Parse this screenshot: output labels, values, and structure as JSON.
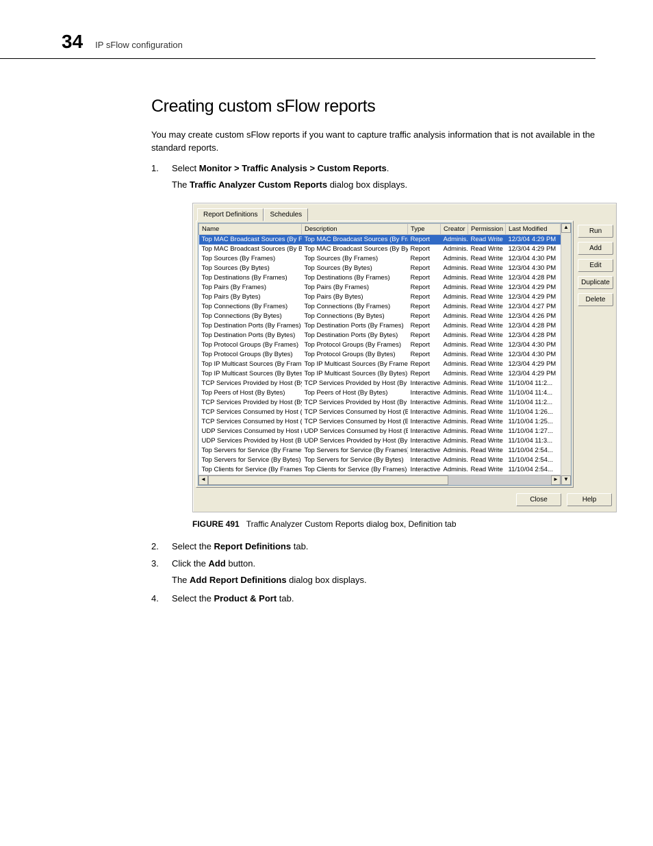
{
  "header": {
    "page_number": "34",
    "section": "IP sFlow configuration"
  },
  "title": "Creating custom sFlow reports",
  "intro": "You may create custom sFlow reports if you want to capture traffic analysis information that is not available in the standard reports.",
  "steps": {
    "s1_num": "1.",
    "s1_pre": "Select ",
    "s1_strong": "Monitor > Traffic Analysis > Custom Reports",
    "s1_post": ".",
    "s1_ind_pre": "The ",
    "s1_ind_strong": "Traffic Analyzer Custom Reports",
    "s1_ind_post": " dialog box displays.",
    "s2_num": "2.",
    "s2_pre": "Select the ",
    "s2_strong": "Report Definitions",
    "s2_post": " tab.",
    "s3_num": "3.",
    "s3_pre": "Click the ",
    "s3_strong": "Add",
    "s3_post": " button.",
    "s3_ind_pre": "The ",
    "s3_ind_strong": "Add Report Definitions",
    "s3_ind_post": " dialog box displays.",
    "s4_num": "4.",
    "s4_pre": "Select the ",
    "s4_strong": "Product & Port",
    "s4_post": " tab."
  },
  "dialog": {
    "tabs": {
      "t1": "Report Definitions",
      "t2": "Schedules"
    },
    "columns": {
      "name": "Name",
      "desc": "Description",
      "type": "Type",
      "creator": "Creator",
      "perm": "Permission",
      "mod": "Last Modified"
    },
    "side_buttons": {
      "run": "Run",
      "add": "Add",
      "edit": "Edit",
      "dup": "Duplicate",
      "del": "Delete"
    },
    "bottom_buttons": {
      "close": "Close",
      "help": "Help"
    },
    "rows": [
      {
        "name": "Top MAC Broadcast Sources (By Fram...",
        "desc": "Top MAC Broadcast Sources (By Frames)",
        "type": "Report",
        "creator": "Adminis...",
        "perm": "Read Write",
        "mod": "12/3/04 4:29 PM",
        "sel": true
      },
      {
        "name": "Top MAC Broadcast Sources (By Bytes)",
        "desc": "Top MAC Broadcast Sources (By Bytes)",
        "type": "Report",
        "creator": "Adminis...",
        "perm": "Read Write",
        "mod": "12/3/04 4:29 PM"
      },
      {
        "name": "Top Sources (By Frames)",
        "desc": "Top Sources (By Frames)",
        "type": "Report",
        "creator": "Adminis...",
        "perm": "Read Write",
        "mod": "12/3/04 4:30 PM"
      },
      {
        "name": "Top Sources (By Bytes)",
        "desc": "Top Sources (By Bytes)",
        "type": "Report",
        "creator": "Adminis...",
        "perm": "Read Write",
        "mod": "12/3/04 4:30 PM"
      },
      {
        "name": "Top Destinations (By Frames)",
        "desc": "Top Destinations (By Frames)",
        "type": "Report",
        "creator": "Adminis...",
        "perm": "Read Write",
        "mod": "12/3/04 4:28 PM"
      },
      {
        "name": "Top Pairs (By Frames)",
        "desc": "Top Pairs  (By Frames)",
        "type": "Report",
        "creator": "Adminis...",
        "perm": "Read Write",
        "mod": "12/3/04 4:29 PM"
      },
      {
        "name": "Top Pairs (By Bytes)",
        "desc": "Top Pairs  (By Bytes)",
        "type": "Report",
        "creator": "Adminis...",
        "perm": "Read Write",
        "mod": "12/3/04 4:29 PM"
      },
      {
        "name": "Top Connections (By Frames)",
        "desc": "Top Connections  (By Frames)",
        "type": "Report",
        "creator": "Adminis...",
        "perm": "Read Write",
        "mod": "12/3/04 4:27 PM"
      },
      {
        "name": "Top Connections (By Bytes)",
        "desc": "Top Connections  (By Bytes)",
        "type": "Report",
        "creator": "Adminis...",
        "perm": "Read Write",
        "mod": "12/3/04 4:26 PM"
      },
      {
        "name": "Top Destination Ports (By Frames)",
        "desc": "Top Destination Ports (By Frames)",
        "type": "Report",
        "creator": "Adminis...",
        "perm": "Read Write",
        "mod": "12/3/04 4:28 PM"
      },
      {
        "name": "Top Destination Ports (By Bytes)",
        "desc": "Top Destination Ports (By Bytes)",
        "type": "Report",
        "creator": "Adminis...",
        "perm": "Read Write",
        "mod": "12/3/04 4:28 PM"
      },
      {
        "name": "Top Protocol Groups (By Frames)",
        "desc": "Top Protocol Groups (By Frames)",
        "type": "Report",
        "creator": "Adminis...",
        "perm": "Read Write",
        "mod": "12/3/04 4:30 PM"
      },
      {
        "name": "Top Protocol Groups (By Bytes)",
        "desc": "Top Protocol Groups (By Bytes)",
        "type": "Report",
        "creator": "Adminis...",
        "perm": "Read Write",
        "mod": "12/3/04 4:30 PM"
      },
      {
        "name": "Top IP Multicast Sources (By Frames)",
        "desc": "Top IP Multicast Sources (By Frames)",
        "type": "Report",
        "creator": "Adminis...",
        "perm": "Read Write",
        "mod": "12/3/04 4:29 PM"
      },
      {
        "name": "Top IP Multicast Sources (By Bytes)",
        "desc": "Top IP Multicast Sources (By Bytes)",
        "type": "Report",
        "creator": "Adminis...",
        "perm": "Read Write",
        "mod": "12/3/04 4:29 PM"
      },
      {
        "name": "TCP Services Provided by Host (By Fr...",
        "desc": "TCP Services Provided by Host (By Frames)",
        "type": "Interactive",
        "creator": "Adminis...",
        "perm": "Read Write",
        "mod": "11/10/04 11:2..."
      },
      {
        "name": "Top Peers of Host (By Bytes)",
        "desc": "Top Peers of Host (By Bytes)",
        "type": "Interactive",
        "creator": "Adminis...",
        "perm": "Read Write",
        "mod": "11/10/04 11:4..."
      },
      {
        "name": "TCP Services Provided by Host (By By...",
        "desc": "TCP Services Provided by Host (By Bytes)",
        "type": "Interactive",
        "creator": "Adminis...",
        "perm": "Read Write",
        "mod": "11/10/04 11:2..."
      },
      {
        "name": "TCP Services Consumed by Host (By F...",
        "desc": "TCP Services Consumed by Host (By Fram...",
        "type": "Interactive",
        "creator": "Adminis...",
        "perm": "Read Write",
        "mod": "11/10/04 1:26..."
      },
      {
        "name": "TCP Services Consumed by Host (By ...",
        "desc": "TCP Services Consumed by Host (By Bytes)",
        "type": "Interactive",
        "creator": "Adminis...",
        "perm": "Read Write",
        "mod": "11/10/04 1:25..."
      },
      {
        "name": "UDP Services Consumed by Host (By ...",
        "desc": "UDP Services Consumed by Host (By Fram...",
        "type": "Interactive",
        "creator": "Adminis...",
        "perm": "Read Write",
        "mod": "11/10/04 1:27..."
      },
      {
        "name": "UDP Services Provided by Host (By By...",
        "desc": "UDP Services Provided by Host (By Bytes)",
        "type": "Interactive",
        "creator": "Adminis...",
        "perm": "Read Write",
        "mod": "11/10/04 11:3..."
      },
      {
        "name": "Top Servers for Service (By Frames)",
        "desc": "Top Servers for Service (By Frames)",
        "type": "Interactive",
        "creator": "Adminis...",
        "perm": "Read Write",
        "mod": "11/10/04 2:54..."
      },
      {
        "name": "Top Servers for Service (By Bytes)",
        "desc": "Top Servers for Service (By Bytes)",
        "type": "Interactive",
        "creator": "Adminis...",
        "perm": "Read Write",
        "mod": "11/10/04 2:54..."
      },
      {
        "name": "Top Clients for Service (By Frames)",
        "desc": "Top Clients for Service (By Frames)",
        "type": "Interactive",
        "creator": "Adminis...",
        "perm": "Read Write",
        "mod": "11/10/04 2:54..."
      }
    ]
  },
  "figure": {
    "label": "FIGURE 491",
    "caption": "Traffic Analyzer Custom Reports dialog box, Definition tab"
  }
}
